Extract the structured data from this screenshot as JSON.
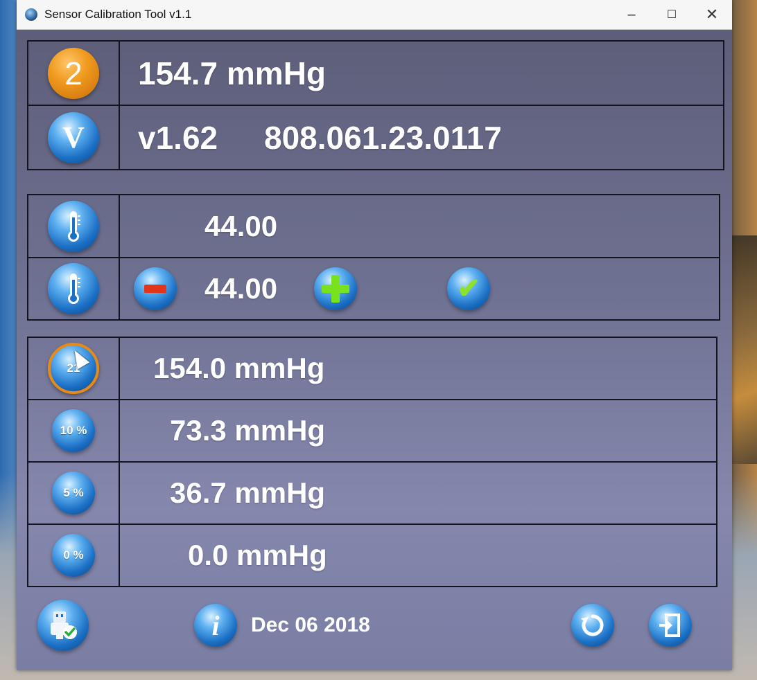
{
  "window": {
    "title": "Sensor Calibration Tool v1.1",
    "controls": {
      "minimize": "–",
      "maximize": "☐",
      "close": "✕"
    }
  },
  "info": {
    "badge_number": "2",
    "pressure": "154.7 mmHg",
    "version_badge": "V",
    "version": "v1.62",
    "serial": "808.061.23.0117"
  },
  "temperature": {
    "measured": "44.00",
    "setpoint": "44.00",
    "icons": [
      "thermometer-icon",
      "thermometer-icon",
      "minus-icon",
      "plus-icon",
      "check-icon"
    ]
  },
  "calibration": {
    "rows": [
      {
        "label": "21",
        "value": "154.0 mmHg",
        "selected": true
      },
      {
        "label": "10 %",
        "value": "73.3 mmHg",
        "selected": false
      },
      {
        "label": "5 %",
        "value": "36.7 mmHg",
        "selected": false
      },
      {
        "label": "0 %",
        "value": "0.0 mmHg",
        "selected": false
      }
    ]
  },
  "footer": {
    "date": "Dec 06 2018",
    "info_glyph": "i",
    "icons": [
      "usb-connected-icon",
      "info-icon",
      "refresh-icon",
      "exit-icon"
    ]
  },
  "colors": {
    "background": "#6c6d8a",
    "accent_orange": "#f09a1f",
    "icon_blue": "#1b6fc4",
    "minus_red": "#e2361a",
    "plus_green": "#79e21f"
  }
}
